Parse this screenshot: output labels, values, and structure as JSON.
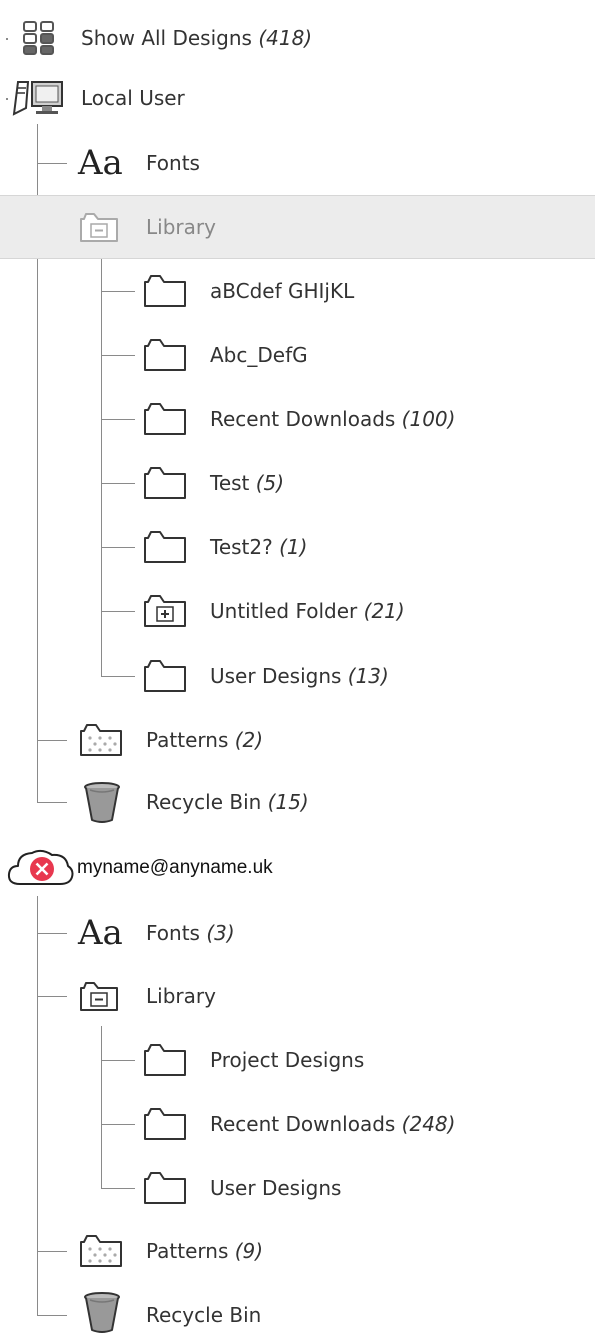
{
  "show_all": {
    "label": "Show All Designs",
    "count": "(418)"
  },
  "local_user": {
    "label": "Local User",
    "fonts": {
      "label": "Fonts",
      "count": ""
    },
    "library": {
      "label": "Library",
      "folders": [
        {
          "label": "aBCdef GHIjKL",
          "count": ""
        },
        {
          "label": "Abc_DefG",
          "count": ""
        },
        {
          "label": "Recent Downloads",
          "count": "(100)"
        },
        {
          "label": "Test",
          "count": "(5)"
        },
        {
          "label": "Test2?",
          "count": "(1)"
        },
        {
          "label": "Untitled Folder",
          "count": "(21)"
        },
        {
          "label": "User Designs",
          "count": "(13)"
        }
      ]
    },
    "patterns": {
      "label": "Patterns",
      "count": "(2)"
    },
    "recycle_bin": {
      "label": "Recycle Bin",
      "count": "(15)"
    }
  },
  "cloud_user": {
    "label": "myname@anyname.uk",
    "fonts": {
      "label": "Fonts",
      "count": "(3)"
    },
    "library": {
      "label": "Library",
      "folders": [
        {
          "label": "Project Designs",
          "count": ""
        },
        {
          "label": "Recent Downloads",
          "count": "(248)"
        },
        {
          "label": "User Designs",
          "count": ""
        }
      ]
    },
    "patterns": {
      "label": "Patterns",
      "count": "(9)"
    },
    "recycle_bin": {
      "label": "Recycle Bin",
      "count": ""
    }
  },
  "icon_glyphs": {
    "fonts": "Aa"
  },
  "colors": {
    "selected_row": "#ececec",
    "error_badge": "#e8384f",
    "tree_line": "#8a8a8a"
  }
}
